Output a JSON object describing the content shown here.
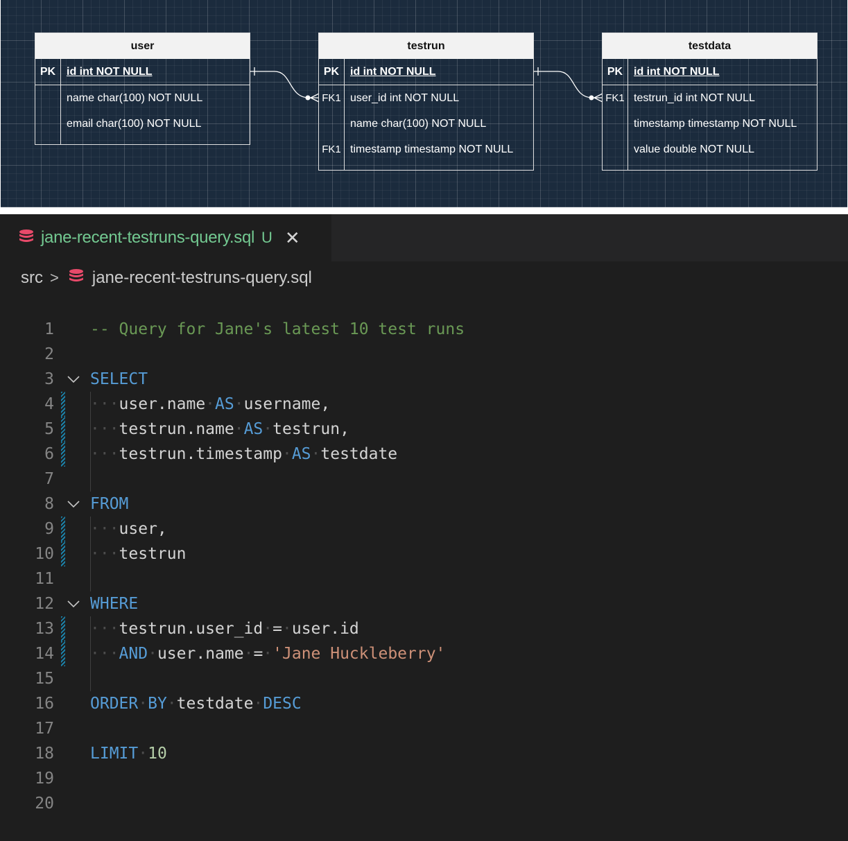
{
  "diagram": {
    "entities": [
      {
        "title": "user",
        "pk": {
          "key": "PK",
          "column": "id int NOT NULL"
        },
        "columns": [
          {
            "key": "",
            "column": "name char(100) NOT NULL"
          },
          {
            "key": "",
            "column": "email char(100) NOT NULL"
          }
        ]
      },
      {
        "title": "testrun",
        "pk": {
          "key": "PK",
          "column": "id int NOT NULL"
        },
        "columns": [
          {
            "key": "FK1",
            "column": "user_id int NOT NULL"
          },
          {
            "key": "",
            "column": "name char(100) NOT NULL"
          },
          {
            "key": "FK1",
            "column": "timestamp timestamp NOT NULL"
          }
        ]
      },
      {
        "title": "testdata",
        "pk": {
          "key": "PK",
          "column": "id int NOT NULL"
        },
        "columns": [
          {
            "key": "FK1",
            "column": "testrun_id int NOT NULL"
          },
          {
            "key": "",
            "column": "timestamp timestamp NOT NULL"
          },
          {
            "key": "",
            "column": "value double NOT NULL"
          }
        ]
      }
    ],
    "background_color": "#1b2b3d"
  },
  "tab": {
    "filename": "jane-recent-testruns-query.sql",
    "status": "U",
    "close_glyph": "✕",
    "icon": "database-icon",
    "label_color": "#73c991"
  },
  "breadcrumb": {
    "folder": "src",
    "separator": ">",
    "file": "jane-recent-testruns-query.sql",
    "file_icon": "database-icon"
  },
  "editor": {
    "line_numbers": [
      "1",
      "2",
      "3",
      "4",
      "5",
      "6",
      "7",
      "8",
      "9",
      "10",
      "11",
      "12",
      "13",
      "14",
      "15",
      "16",
      "17",
      "18",
      "19",
      "20"
    ],
    "lines": {
      "l2": {
        "comment": "-- Query for Jane's latest 10 test runs"
      },
      "l4": {
        "kw": "SELECT"
      },
      "l5": {
        "a": "user.name",
        "kw": "AS",
        "b": "username,"
      },
      "l6": {
        "a": "testrun.name",
        "kw": "AS",
        "b": "testrun,"
      },
      "l7": {
        "a": "testrun.timestamp",
        "kw": "AS",
        "b": "testdate"
      },
      "l9": {
        "kw": "FROM"
      },
      "l10": {
        "a": "user,"
      },
      "l11": {
        "a": "testrun"
      },
      "l13": {
        "kw": "WHERE"
      },
      "l14": {
        "a": "testrun.user_id",
        "op": "=",
        "b": "user.id"
      },
      "l15": {
        "kw": "AND",
        "a": "user.name",
        "op": "=",
        "str": "'Jane Huckleberry'"
      },
      "l17": {
        "kw1": "ORDER",
        "kw2": "BY",
        "a": "testdate",
        "kw3": "DESC"
      },
      "l19": {
        "kw": "LIMIT",
        "num": "10"
      }
    },
    "colors": {
      "keyword": "#569cd6",
      "comment": "#6a9955",
      "string": "#ce9178",
      "number": "#b5cea8",
      "text": "#d4d4d4"
    }
  }
}
